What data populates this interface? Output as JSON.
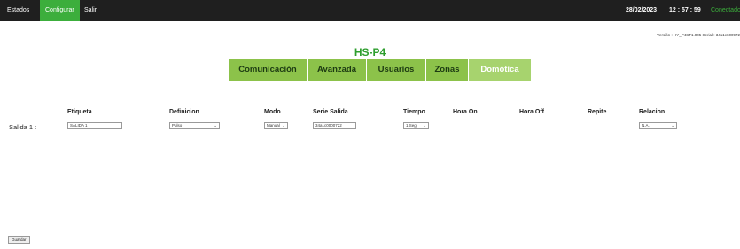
{
  "topbar": {
    "menu": [
      "Estados",
      "Configurar",
      "Salir"
    ],
    "date": "28/02/2023",
    "time": "12 : 57 : 59",
    "status": "Conectado"
  },
  "version_line": "Versión : HY_P4ST1.005  Serial : 34a1c600972",
  "device_title": "HS-P4",
  "tabs": [
    "Comunicación",
    "Avanzada",
    "Usuarios",
    "Zonas",
    "Domótica"
  ],
  "table": {
    "columns": [
      "Etiqueta",
      "Definicion",
      "Modo",
      "Serie Salida",
      "Tiempo",
      "Hora On",
      "Hora Off",
      "Repite",
      "Relacion"
    ],
    "row": {
      "label": "Salida 1 :",
      "etiqueta": "SALIDA 1",
      "definicion": "Pulso",
      "modo": "Manual",
      "serie": "34a1c0000722",
      "tiempo": "1 Seg",
      "relacion": "N.A."
    }
  },
  "save_button": "Guardar",
  "colors": {
    "topbar": "#1f1f1f",
    "accent": "#3cae3c",
    "tab": "#8cc24a",
    "tab_active": "#a7d36e"
  }
}
